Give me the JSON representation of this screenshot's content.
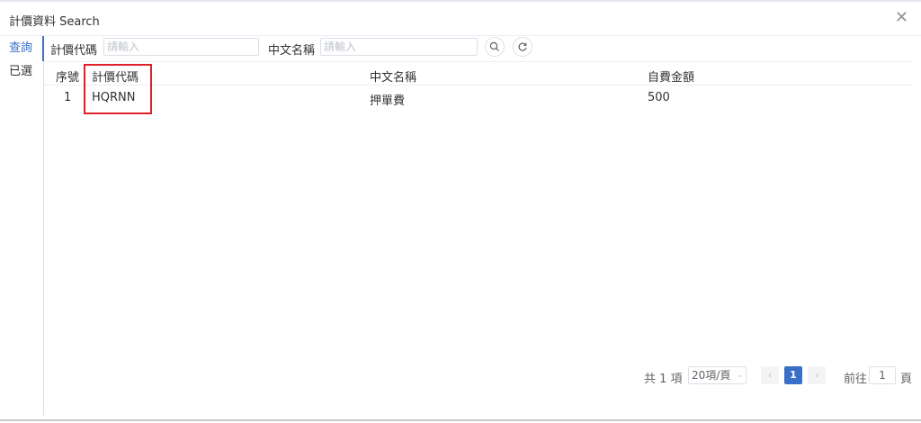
{
  "dialog": {
    "title": "計價資料 Search"
  },
  "side_tabs": [
    {
      "label": "查詢"
    },
    {
      "label": "已選"
    }
  ],
  "filter": {
    "code_label": "計價代碼",
    "code_placeholder": "請輸入",
    "name_label": "中文名稱",
    "name_placeholder": "請輸入"
  },
  "table": {
    "headers": [
      "序號",
      "計價代碼",
      "中文名稱",
      "自費金額"
    ],
    "rows": [
      {
        "seq": "1",
        "code": "HQRNN",
        "name": "押單費",
        "amount": "500"
      }
    ]
  },
  "pagination": {
    "total": "共 1 項",
    "page_size": "20項/頁",
    "current_page": "1",
    "goto_label": "前往",
    "goto_value": "1",
    "page_suffix": "頁"
  },
  "colors": {
    "accent": "#3a6fc8",
    "highlight": "#e0202a"
  }
}
